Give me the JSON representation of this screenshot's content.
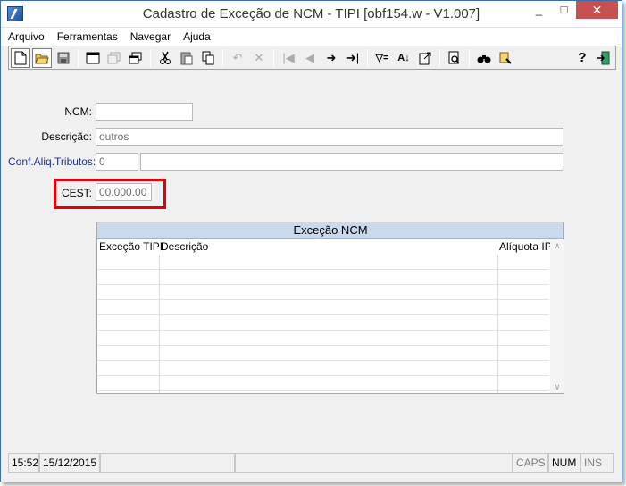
{
  "window": {
    "title": "Cadastro de Exceção de NCM - TIPI [obf154.w - V1.007]",
    "minimize_glyph": "_",
    "maximize_glyph": "□",
    "close_glyph": "✕"
  },
  "menu": [
    "Arquivo",
    "Ferramentas",
    "Navegar",
    "Ajuda"
  ],
  "toolbar": {
    "icons": [
      "new-document-icon",
      "open-folder-icon",
      "save-icon",
      "window-icon",
      "copy-window-icon",
      "duplicate-icon",
      "cut-icon",
      "paste-icon",
      "copy-icon",
      "undo-icon",
      "delete-icon",
      "first-record-icon",
      "previous-record-icon",
      "next-record-icon",
      "last-record-icon",
      "filter-icon",
      "sort-icon",
      "export-icon",
      "print-preview-icon",
      "search-icon",
      "tools-icon",
      "help-icon",
      "exit-icon"
    ],
    "help_glyph": "?"
  },
  "form": {
    "ncm": {
      "label": "NCM:",
      "value": ""
    },
    "descricao": {
      "label": "Descrição:",
      "value": "outros"
    },
    "conf_aliq": {
      "label": "Conf.Aliq.Tributos:",
      "value": "0",
      "desc": ""
    },
    "cest": {
      "label": "CEST:",
      "value": "00.000.00"
    }
  },
  "highlight_color": "#e0000a",
  "grid": {
    "title": "Exceção NCM",
    "columns": [
      "Exceção TIPI",
      "Descrição",
      "Alíquota IPI"
    ],
    "rows": [],
    "visible_empty_rows": 9
  },
  "statusbar": {
    "time": "15:52",
    "date": "15/12/2015",
    "caps": "CAPS",
    "num": "NUM",
    "ins": "INS"
  }
}
